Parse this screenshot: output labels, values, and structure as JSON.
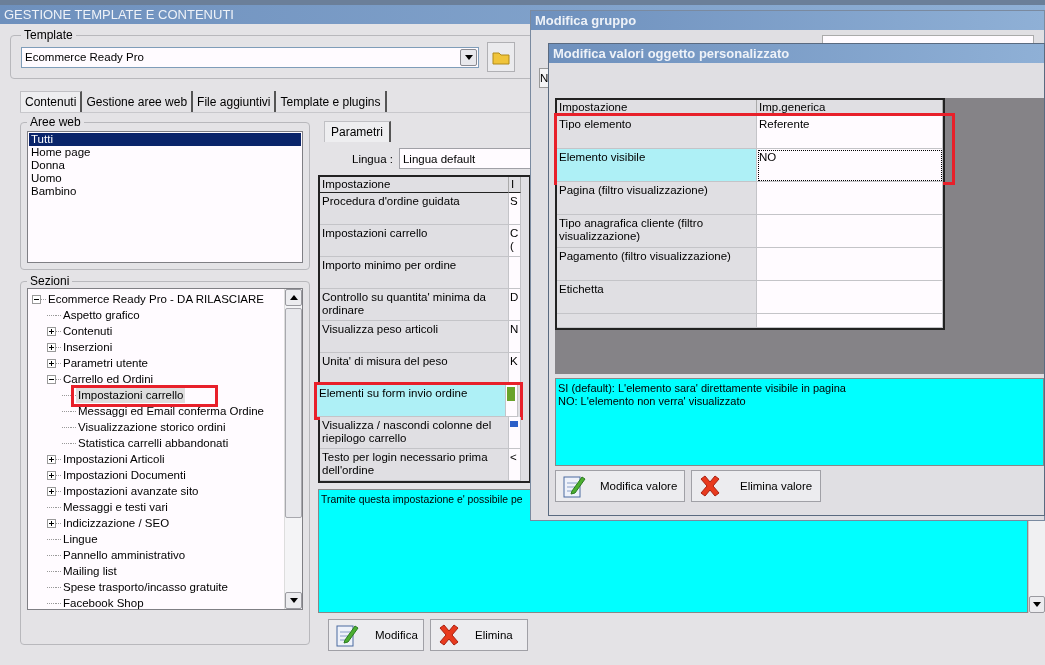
{
  "main_window": {
    "title": "GESTIONE TEMPLATE E CONTENUTI",
    "template": {
      "label": "Template",
      "value": "Ecommerce Ready Pro"
    },
    "tabs": [
      {
        "label": "Contenuti",
        "selected": true
      },
      {
        "label": "Gestione aree web",
        "selected": false
      },
      {
        "label": "File aggiuntivi",
        "selected": false
      },
      {
        "label": "Template e plugins",
        "selected": false
      }
    ],
    "aree_web": {
      "label": "Aree web",
      "items": [
        {
          "label": "Tutti",
          "selected": true
        },
        {
          "label": "Home page",
          "selected": false
        },
        {
          "label": "Donna",
          "selected": false
        },
        {
          "label": "Uomo",
          "selected": false
        },
        {
          "label": "Bambino",
          "selected": false
        }
      ]
    },
    "sezioni": {
      "label": "Sezioni",
      "tree": [
        {
          "label": "Ecommerce Ready Pro - DA RILASCIARE",
          "kind": "folder",
          "expanded": true,
          "selected": false,
          "highlighted": false,
          "children": [
            {
              "label": "Aspetto grafico",
              "kind": "leaf",
              "selected": false,
              "highlighted": false
            },
            {
              "label": "Contenuti",
              "kind": "folder",
              "expanded": false,
              "selected": false,
              "highlighted": false
            },
            {
              "label": "Inserzioni",
              "kind": "folder",
              "expanded": false,
              "selected": false,
              "highlighted": false
            },
            {
              "label": "Parametri utente",
              "kind": "folder",
              "expanded": false,
              "selected": false,
              "highlighted": false
            },
            {
              "label": "Carrello ed Ordini",
              "kind": "folder",
              "expanded": true,
              "selected": false,
              "highlighted": false,
              "children": [
                {
                  "label": "Impostazioni carrello",
                  "kind": "leaf",
                  "selected": true,
                  "highlighted": true
                },
                {
                  "label": "Messaggi ed Email conferma Ordine",
                  "kind": "leaf",
                  "selected": false,
                  "highlighted": false
                },
                {
                  "label": "Visualizzazione storico ordini",
                  "kind": "leaf",
                  "selected": false,
                  "highlighted": false
                },
                {
                  "label": "Statistica carrelli abbandonati",
                  "kind": "leaf",
                  "selected": false,
                  "highlighted": false
                }
              ]
            },
            {
              "label": "Impostazioni Articoli",
              "kind": "folder",
              "expanded": false,
              "selected": false,
              "highlighted": false
            },
            {
              "label": "Impostazioni Documenti",
              "kind": "folder",
              "expanded": false,
              "selected": false,
              "highlighted": false
            },
            {
              "label": "Impostazioni avanzate sito",
              "kind": "folder",
              "expanded": false,
              "selected": false,
              "highlighted": false
            },
            {
              "label": "Messaggi e testi vari",
              "kind": "leaf",
              "selected": false,
              "highlighted": false
            },
            {
              "label": "Indicizzazione / SEO",
              "kind": "folder",
              "expanded": false,
              "selected": false,
              "highlighted": false
            },
            {
              "label": "Lingue",
              "kind": "leaf",
              "selected": false,
              "highlighted": false
            },
            {
              "label": "Pannello amministrativo",
              "kind": "leaf",
              "selected": false,
              "highlighted": false
            },
            {
              "label": "Mailing list",
              "kind": "leaf",
              "selected": false,
              "highlighted": false
            },
            {
              "label": "Spese trasporto/incasso gratuite",
              "kind": "leaf",
              "selected": false,
              "highlighted": false
            },
            {
              "label": "Facebook Shop",
              "kind": "leaf",
              "selected": false,
              "highlighted": false
            }
          ]
        }
      ]
    },
    "parametri": {
      "tab": "Parametri",
      "lingua_label": "Lingua :",
      "lingua_value": "Lingua default",
      "columns": [
        "Impostazione",
        "I"
      ],
      "rows": [
        {
          "setting": "Procedura d'ordine guidata",
          "value": "S",
          "selected": false,
          "highlighted": false
        },
        {
          "setting": "Impostazioni carrello",
          "value": "C (",
          "selected": false,
          "highlighted": false
        },
        {
          "setting": "Importo minimo per ordine",
          "selected": false,
          "highlighted": false
        },
        {
          "setting": "Controllo su quantita' minima da ordinare",
          "value": "D",
          "selected": false,
          "highlighted": false
        },
        {
          "setting": "Visualizza peso articoli",
          "value": "N",
          "selected": false,
          "highlighted": false
        },
        {
          "setting": "Unita' di misura del peso",
          "value": "K",
          "selected": false,
          "highlighted": false
        },
        {
          "setting": "Elementi su form invio ordine",
          "color": "#6aa32a",
          "selected": true,
          "highlighted": true
        },
        {
          "setting": "Visualizza / nascondi colonne del riepilogo carrello",
          "color": "#2c5fc8",
          "selected": false,
          "highlighted": false
        },
        {
          "setting": "Testo per login necessario prima dell'ordine",
          "value": "<",
          "selected": false,
          "highlighted": false
        }
      ],
      "description": "Tramite questa impostazione e' possibile pe",
      "buttons": [
        {
          "label": "Modifica",
          "kind": "edit"
        },
        {
          "label": "Elimina",
          "kind": "delete"
        }
      ]
    }
  },
  "group_dialog": {
    "title": "Modifica gruppo",
    "field_fragment": "N"
  },
  "value_dialog": {
    "title": "Modifica valori oggetto personalizzato",
    "columns": [
      "Impostazione",
      "Imp.generica"
    ],
    "rows": [
      {
        "setting": "Tipo elemento",
        "value": "Referente",
        "selected": false,
        "focused": false,
        "highlighted": true
      },
      {
        "setting": "Elemento visibile",
        "value": "NO",
        "selected": true,
        "focused": true,
        "highlighted": true
      },
      {
        "setting": "Pagina (filtro visualizzazione)",
        "selected": false,
        "focused": false,
        "highlighted": false
      },
      {
        "setting": "Tipo anagrafica cliente (filtro visualizzazione)",
        "selected": false,
        "focused": false,
        "highlighted": false
      },
      {
        "setting": "Pagamento (filtro visualizzazione)",
        "selected": false,
        "focused": false,
        "highlighted": false
      },
      {
        "setting": "Etichetta",
        "selected": false,
        "focused": false,
        "highlighted": false
      }
    ],
    "description": [
      "SI (default): L'elemento sara' direttamente visibile in pagina",
      "NO: L'elemento non verra' visualizzato"
    ],
    "buttons": [
      {
        "label": "Modifica valore",
        "kind": "edit"
      },
      {
        "label": "Elimina valore",
        "kind": "delete"
      }
    ]
  }
}
